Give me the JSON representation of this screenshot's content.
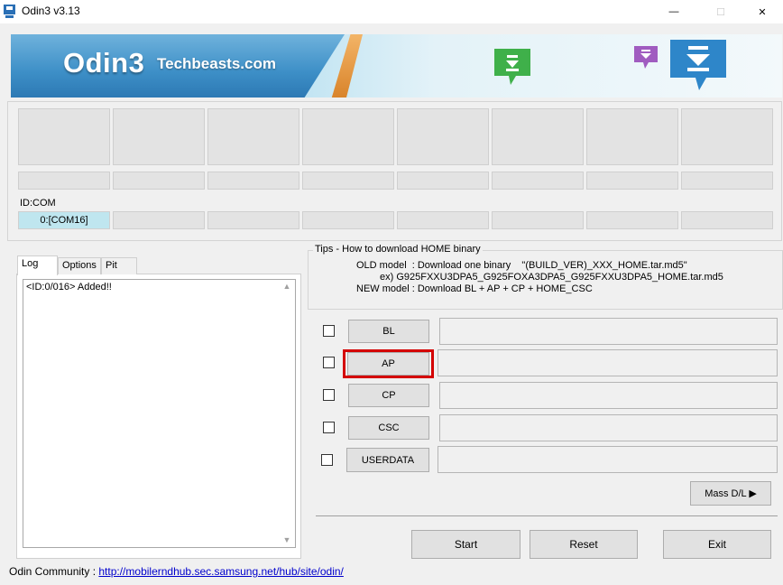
{
  "window": {
    "title": "Odin3 v3.13",
    "controls": {
      "minimize": "—",
      "maximize": "☐",
      "close": "✕"
    }
  },
  "banner": {
    "logo_text": "Odin3",
    "subtitle": "Techbeasts.com"
  },
  "ports": {
    "id_com_label": "ID:COM",
    "com_cells": [
      "0:[COM16]",
      "",
      "",
      "",
      "",
      "",
      "",
      ""
    ]
  },
  "tabs": [
    {
      "label": "Log",
      "active": true
    },
    {
      "label": "Options",
      "active": false
    },
    {
      "label": "Pit",
      "active": false
    }
  ],
  "log": {
    "text": "<ID:0/016> Added!!"
  },
  "tips": {
    "title": "Tips - How to download HOME binary",
    "line1": "OLD model  : Download one binary    \"(BUILD_VER)_XXX_HOME.tar.md5\"",
    "line2": "ex) G925FXXU3DPA5_G925FOXA3DPA5_G925FXXU3DPA5_HOME.tar.md5",
    "line3": "NEW model : Download BL + AP + CP + HOME_CSC"
  },
  "files": [
    {
      "label": "BL",
      "checked": false,
      "path": ""
    },
    {
      "label": "AP",
      "checked": false,
      "path": ""
    },
    {
      "label": "CP",
      "checked": false,
      "path": ""
    },
    {
      "label": "CSC",
      "checked": false,
      "path": ""
    },
    {
      "label": "USERDATA",
      "checked": false,
      "path": ""
    }
  ],
  "buttons": {
    "mass_dl": "Mass D/L ▶",
    "start": "Start",
    "reset": "Reset",
    "exit": "Exit"
  },
  "community": {
    "label": "Odin Community : ",
    "link": "http://mobilerndhub.sec.samsung.net/hub/site/odin/"
  },
  "colors": {
    "highlight": "#d40000",
    "active_port": "#bfe6ef",
    "link": "#0000cc"
  }
}
